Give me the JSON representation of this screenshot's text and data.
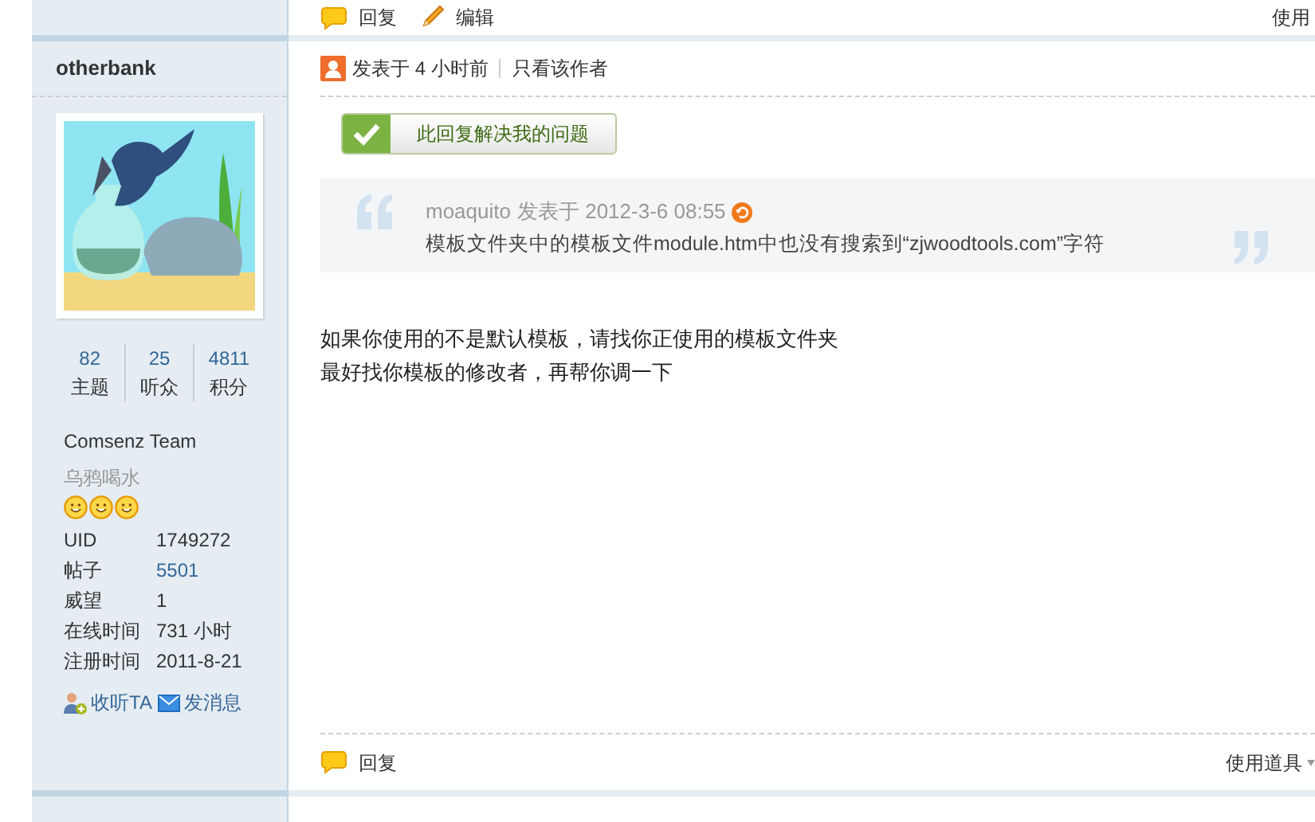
{
  "previous_post_footer": {
    "actions": [
      {
        "kind": "reply",
        "label": "回复"
      },
      {
        "kind": "edit",
        "label": "编辑"
      }
    ],
    "tools_label": "使用"
  },
  "post": {
    "author": {
      "name": "otherbank",
      "stats": [
        {
          "value": "82",
          "label": "主题"
        },
        {
          "value": "25",
          "label": "听众"
        },
        {
          "value": "4811",
          "label": "积分"
        }
      ],
      "group": "Comsenz Team",
      "rank": "乌鸦喝水",
      "stars": 3,
      "fields": [
        {
          "label": "UID",
          "value": "1749272",
          "kind": "text"
        },
        {
          "label": "帖子",
          "value": "5501",
          "kind": "link"
        },
        {
          "label": "威望",
          "value": "1",
          "kind": "text"
        },
        {
          "label": "在线时间",
          "value": "731 小时",
          "kind": "text"
        },
        {
          "label": "注册时间",
          "value": "2011-8-21",
          "kind": "text"
        }
      ],
      "actions": [
        {
          "kind": "follow",
          "label": "收听TA"
        },
        {
          "kind": "message",
          "label": "发消息"
        }
      ]
    },
    "header": {
      "posted": "发表于 4 小时前",
      "author_only": "只看该作者"
    },
    "solve_button": "此回复解决我的问题",
    "quote": {
      "author": "moaquito",
      "meta": "发表于 2012-3-6 08:55",
      "text": "模板文件夹中的模板文件module.htm中也没有搜索到“zjwoodtools.com”字符"
    },
    "body": [
      "如果你使用的不是默认模板，请找你正使用的模板文件夹",
      "最好找你模板的修改者，再帮你调一下"
    ],
    "footer": {
      "reply": "回复",
      "tools": "使用道具"
    }
  }
}
